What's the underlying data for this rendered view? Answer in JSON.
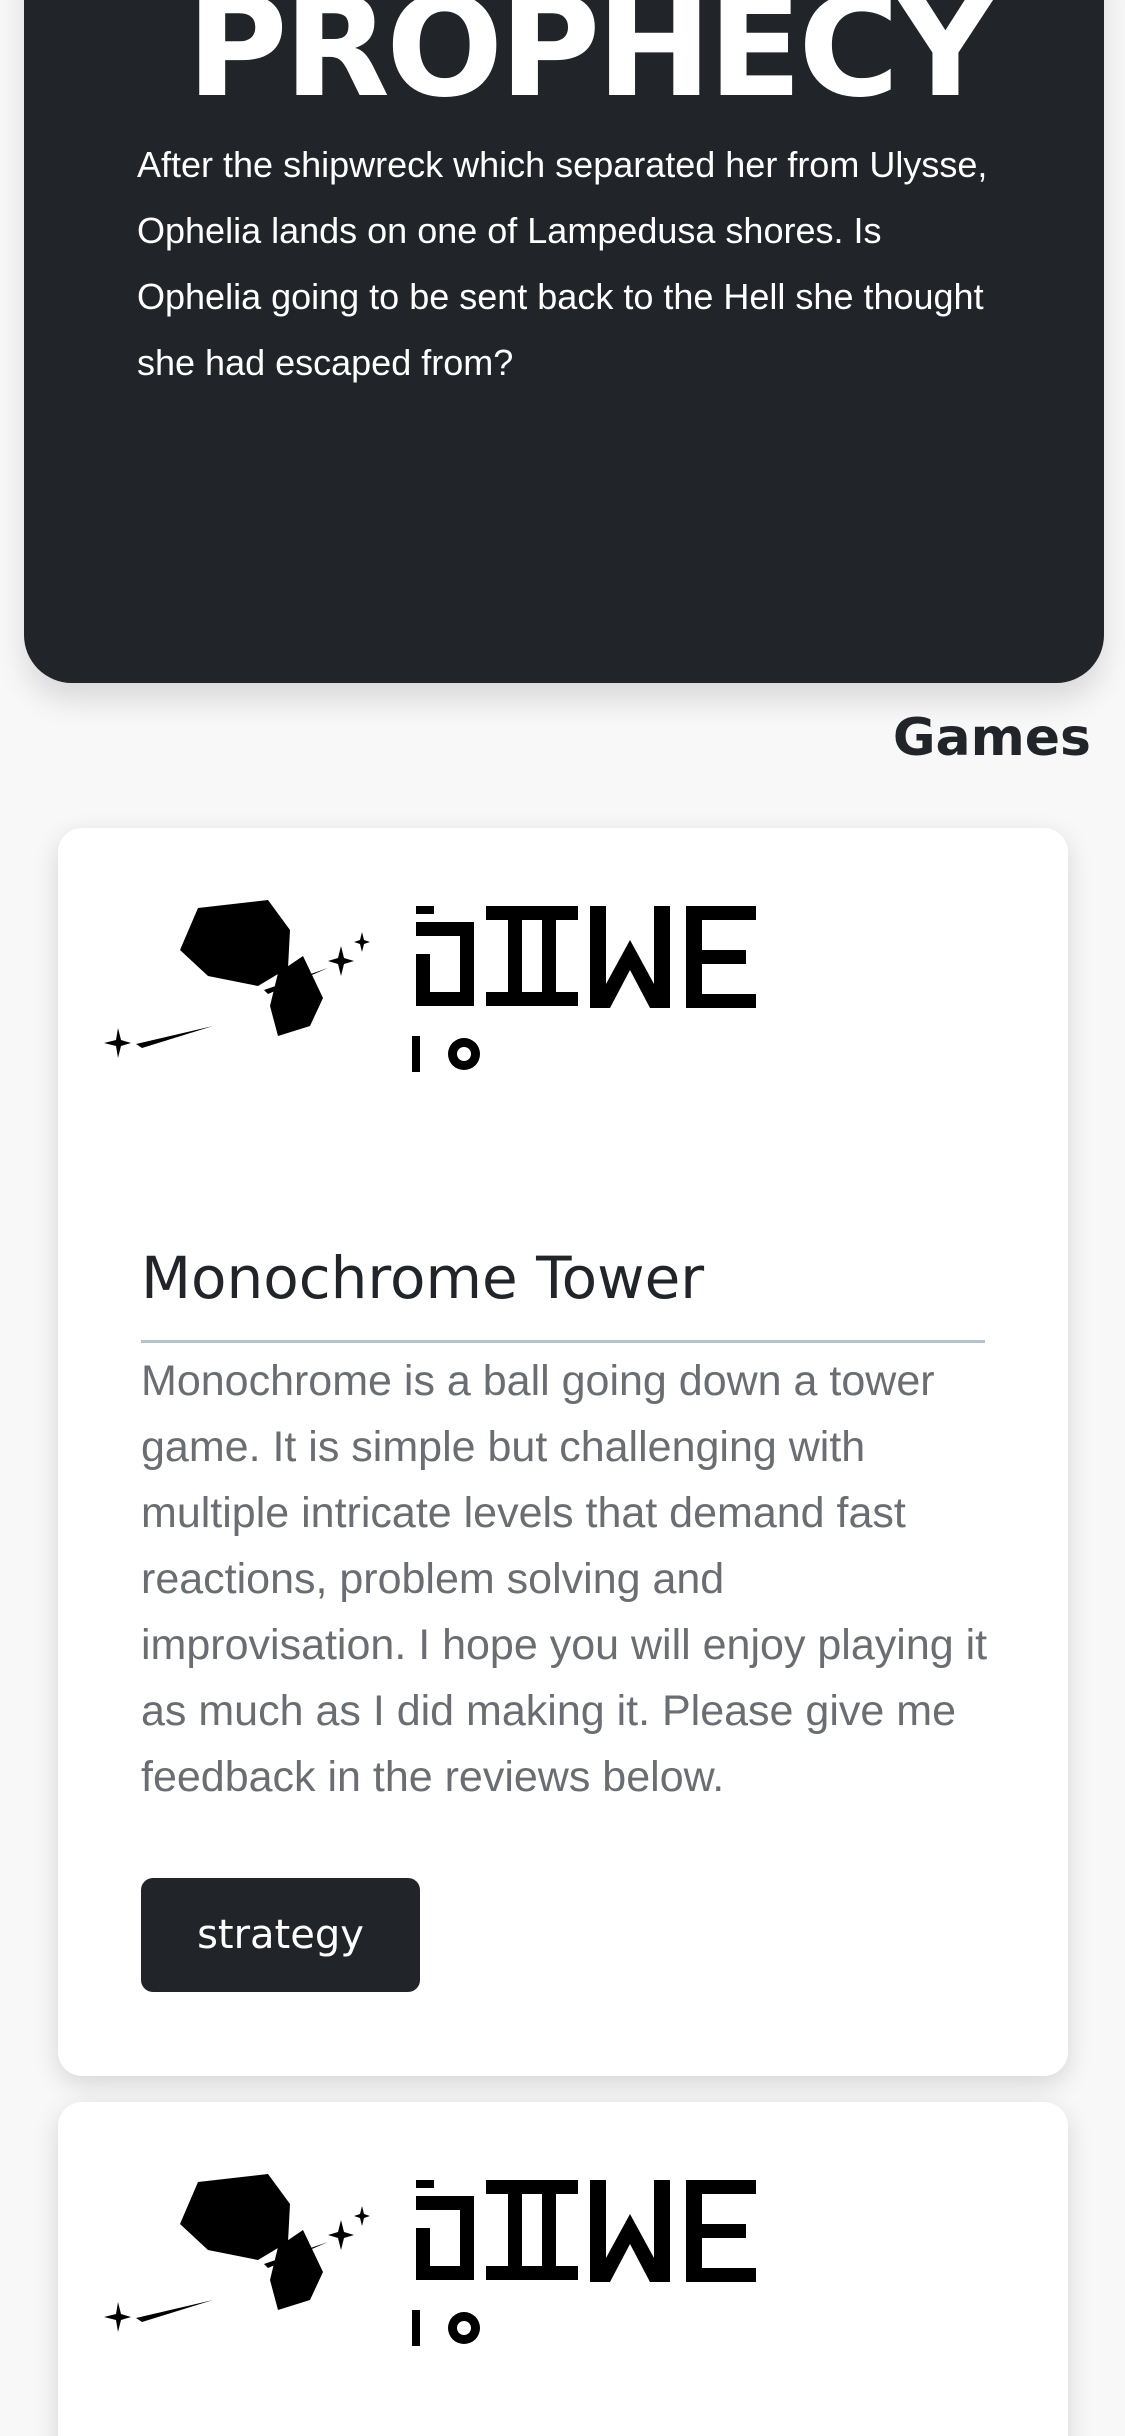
{
  "hero": {
    "title": "PROPHECY",
    "description": "After the shipwreck which separated her from Ulysse, Ophelia lands on one of Lampedusa shores. Is Ophelia going to be sent back to the Hell she thought she had escaped from?"
  },
  "games_section": {
    "heading": "Games"
  },
  "games": [
    {
      "logo_icon": "eliwe-io-logo",
      "title": "Monochrome Tower",
      "description": "Monochrome is a ball going down a tower game. It is simple but challenging with multiple intricate levels that demand fast reactions, problem solving and improvisation. I hope you will enjoy playing it as much as I did making it. Please give me feedback in the reviews below.",
      "tag": "strategy"
    },
    {
      "logo_icon": "eliwe-io-logo"
    }
  ],
  "colors": {
    "dark": "#212429",
    "page_background": "#f8f8f9",
    "card_background": "#ffffff",
    "description_text": "#6a6d71",
    "divider": "#b8c2cc"
  }
}
